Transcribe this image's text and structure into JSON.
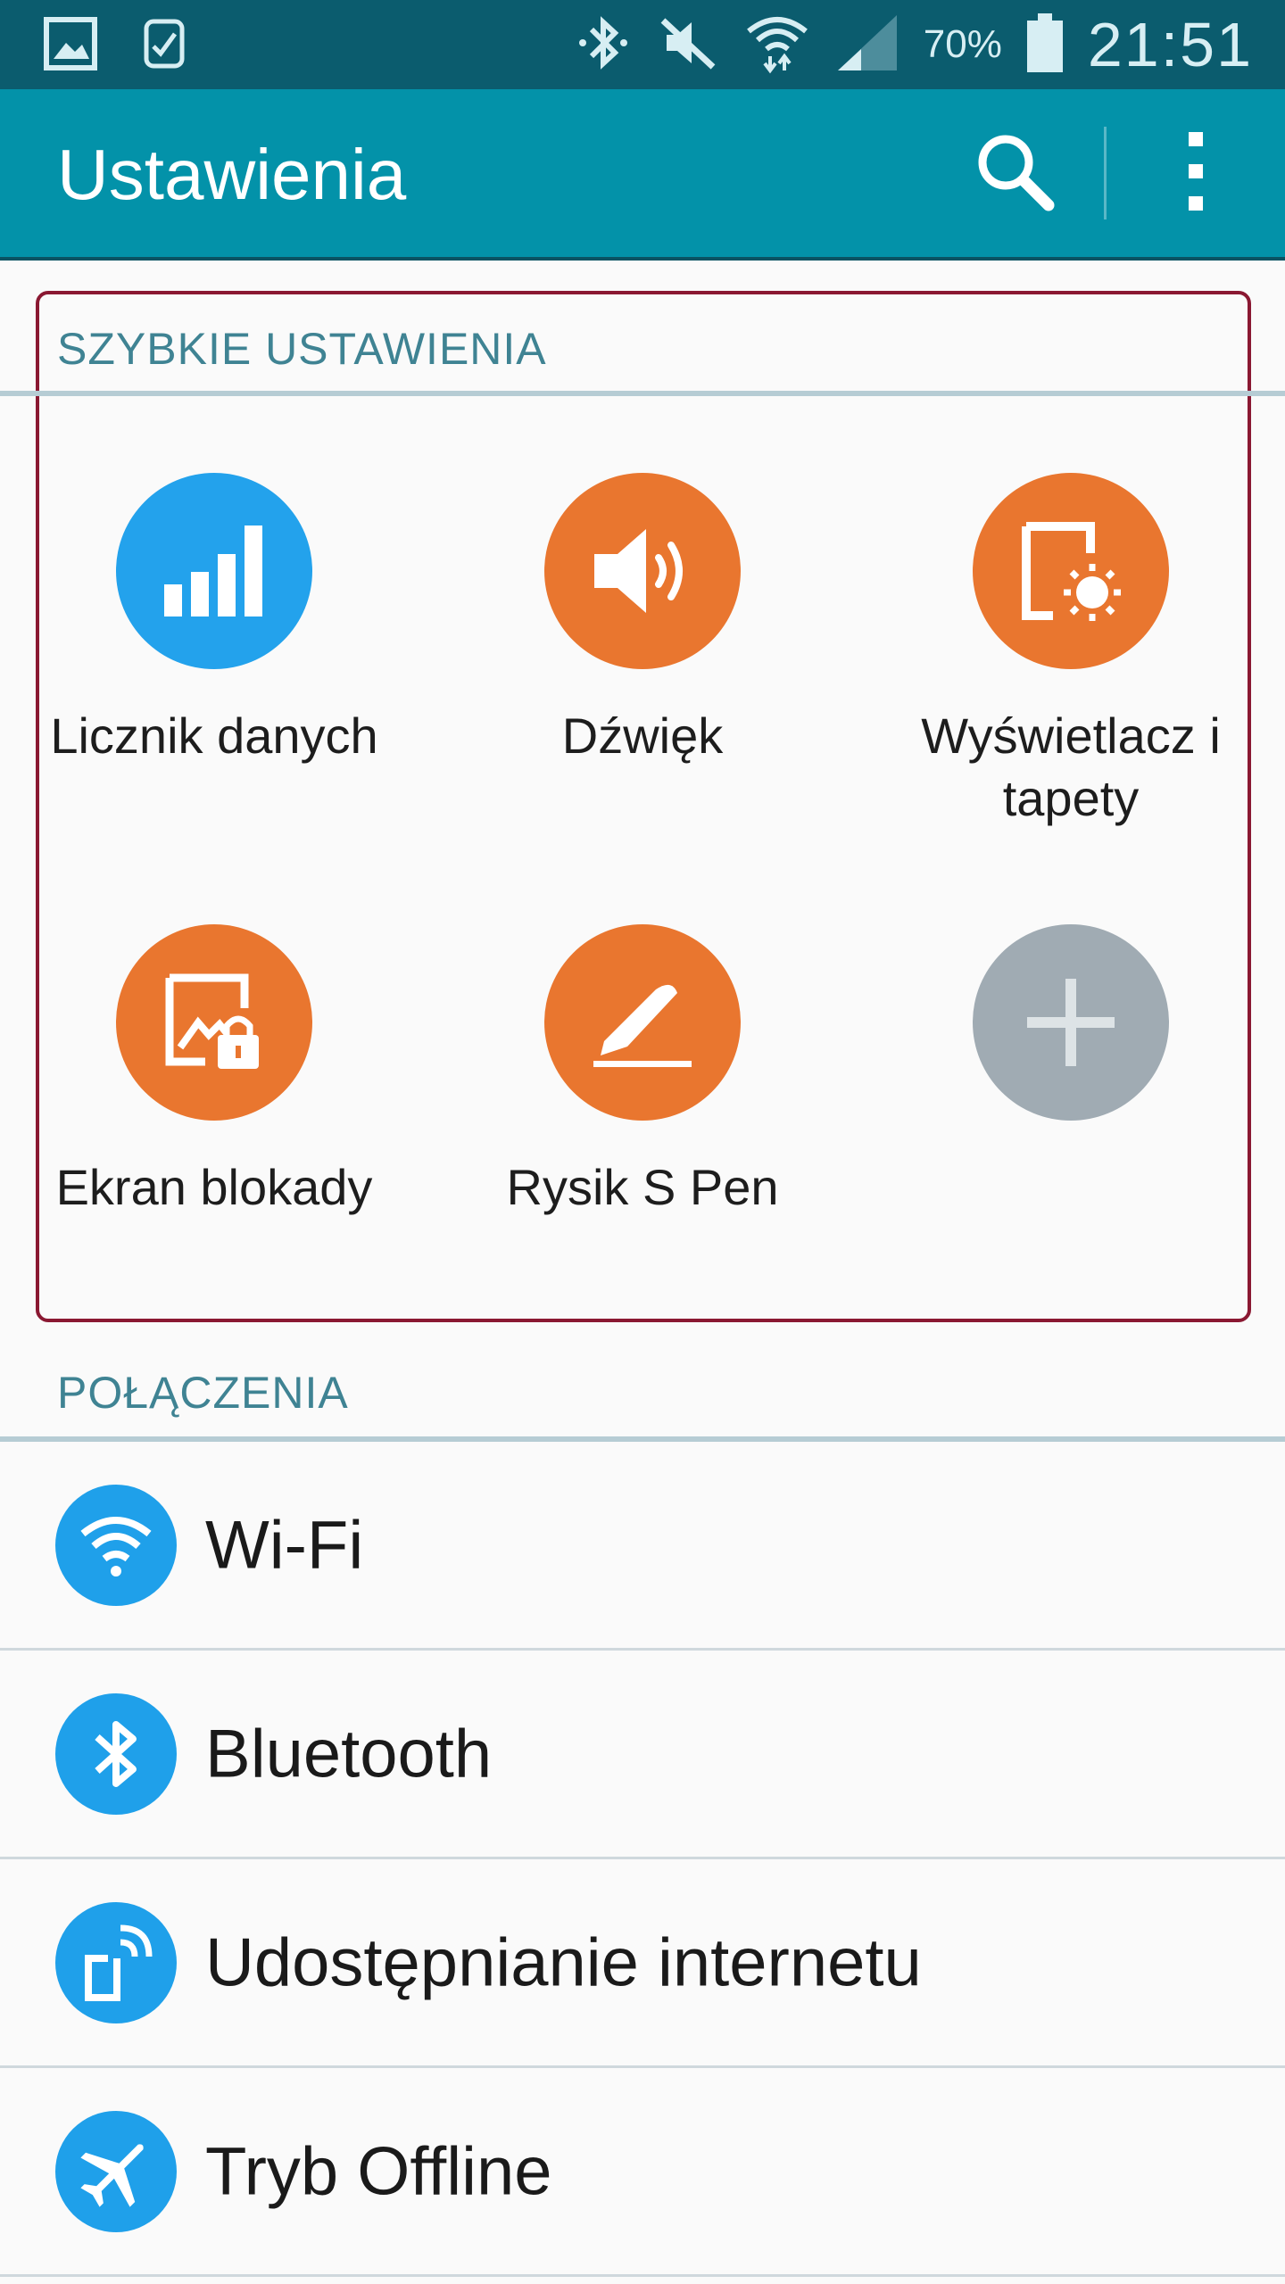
{
  "status_bar": {
    "battery_percent": "70%",
    "time": "21:51"
  },
  "app_bar": {
    "title": "Ustawienia"
  },
  "quick_settings": {
    "header": "SZYBKIE USTAWIENIA",
    "items": [
      {
        "label": "Licznik danych",
        "color": "#23a2ec",
        "icon": "signal-bars-icon"
      },
      {
        "label": "Dźwięk",
        "color": "#e9762f",
        "icon": "speaker-icon"
      },
      {
        "label": "Wyświetlacz i tapety",
        "color": "#e9762f",
        "icon": "display-brightness-icon"
      },
      {
        "label": "Ekran blokady",
        "color": "#e9762f",
        "icon": "lock-screen-icon"
      },
      {
        "label": "Rysik S Pen",
        "color": "#e9762f",
        "icon": "pen-icon"
      },
      {
        "label": "",
        "color": "#a0abb3",
        "icon": "plus-icon"
      }
    ]
  },
  "connections": {
    "header": "POŁĄCZENIA",
    "items": [
      {
        "label": "Wi-Fi",
        "icon": "wifi-icon"
      },
      {
        "label": "Bluetooth",
        "icon": "bluetooth-icon"
      },
      {
        "label": "Udostępnianie internetu",
        "icon": "tethering-icon"
      },
      {
        "label": "Tryb Offline",
        "icon": "airplane-icon"
      }
    ]
  },
  "colors": {
    "status_bar": "#0b5c6e",
    "app_bar": "#0392a9",
    "section_header": "#3f8393",
    "list_icon": "#1fa0ea",
    "frame": "#8a1832"
  }
}
